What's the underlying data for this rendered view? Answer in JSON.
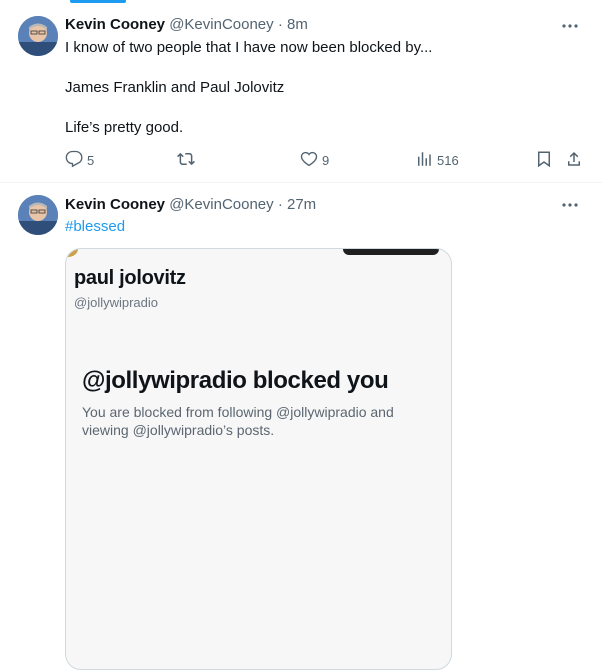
{
  "tweets": [
    {
      "name": "Kevin Cooney",
      "handle": "@KevinCooney",
      "dot": "·",
      "time": "8m",
      "lines": [
        "I know of two people that I have now been blocked by...",
        "James Franklin and Paul Jolovitz",
        "Life’s pretty good."
      ],
      "replies": "5",
      "likes": "9",
      "views": "516"
    },
    {
      "name": "Kevin Cooney",
      "handle": "@KevinCooney",
      "dot": "·",
      "time": "27m",
      "hashtag": "#blessed",
      "media": {
        "profile_name": "paul jolovitz",
        "profile_handle": "@jollywipradio",
        "blocked_title": "@jollywipradio blocked you",
        "blocked_desc": "You are blocked from following @jollywipradio and viewing @jollywipradio’s posts."
      }
    }
  ],
  "colors": {
    "accent": "#1d9bf0",
    "secondary_text": "#536471",
    "divider": "#eff3f4"
  },
  "icons": [
    "more-icon",
    "reply-icon",
    "retweet-icon",
    "like-icon",
    "views-icon",
    "bookmark-icon",
    "share-icon"
  ]
}
